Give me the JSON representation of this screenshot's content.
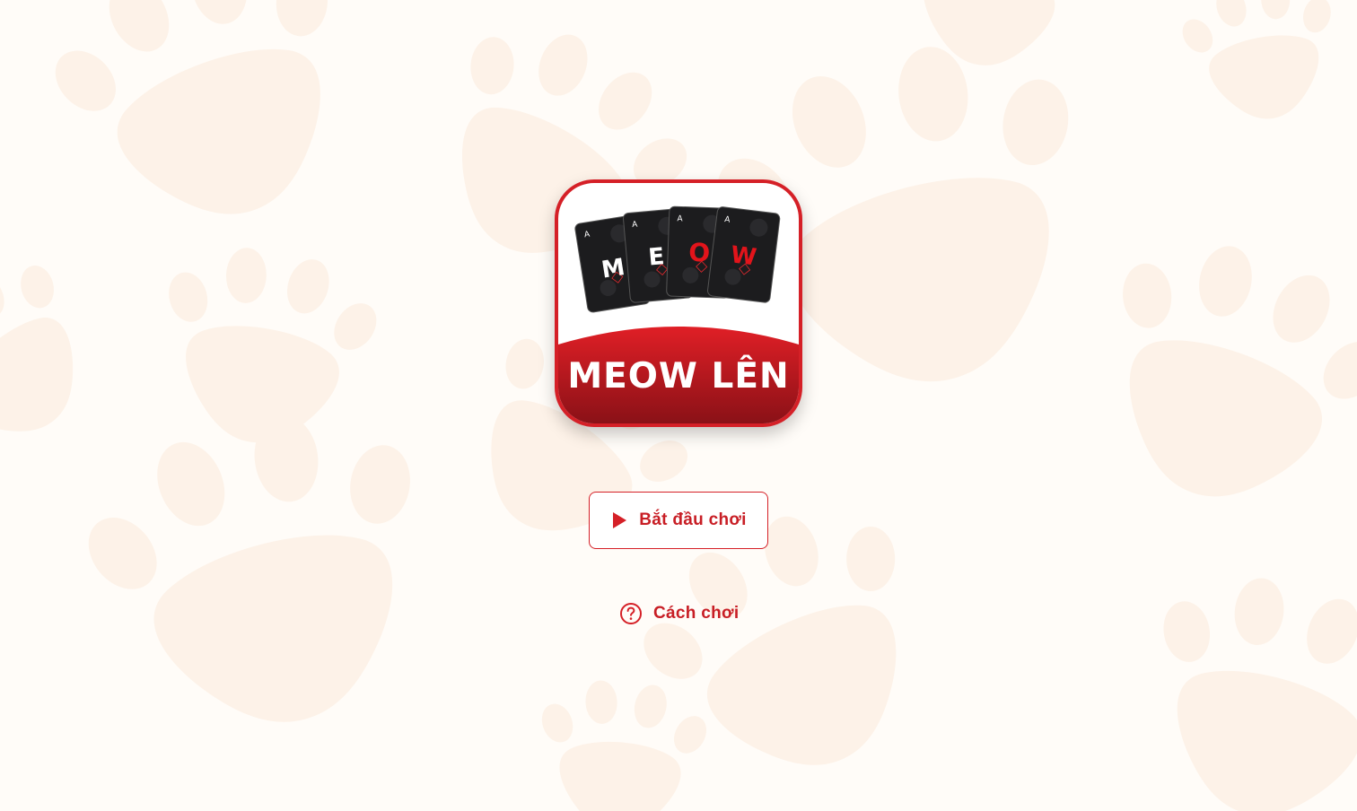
{
  "app": {
    "logo_title": "MEOW LÊN",
    "card_letters": [
      "M",
      "E",
      "O",
      "W"
    ],
    "card_rank": "A"
  },
  "menu": {
    "start_label": "Bắt đầu chơi",
    "how_to_label": "Cách chơi"
  },
  "icons": {
    "start": "play-icon",
    "how_to": "help-circle-icon"
  },
  "colors": {
    "accent": "#d52027",
    "accent_dark": "#8f1318",
    "background": "#fffcf8",
    "paw": "#fdf1e6",
    "card": "#1d1d1f"
  }
}
